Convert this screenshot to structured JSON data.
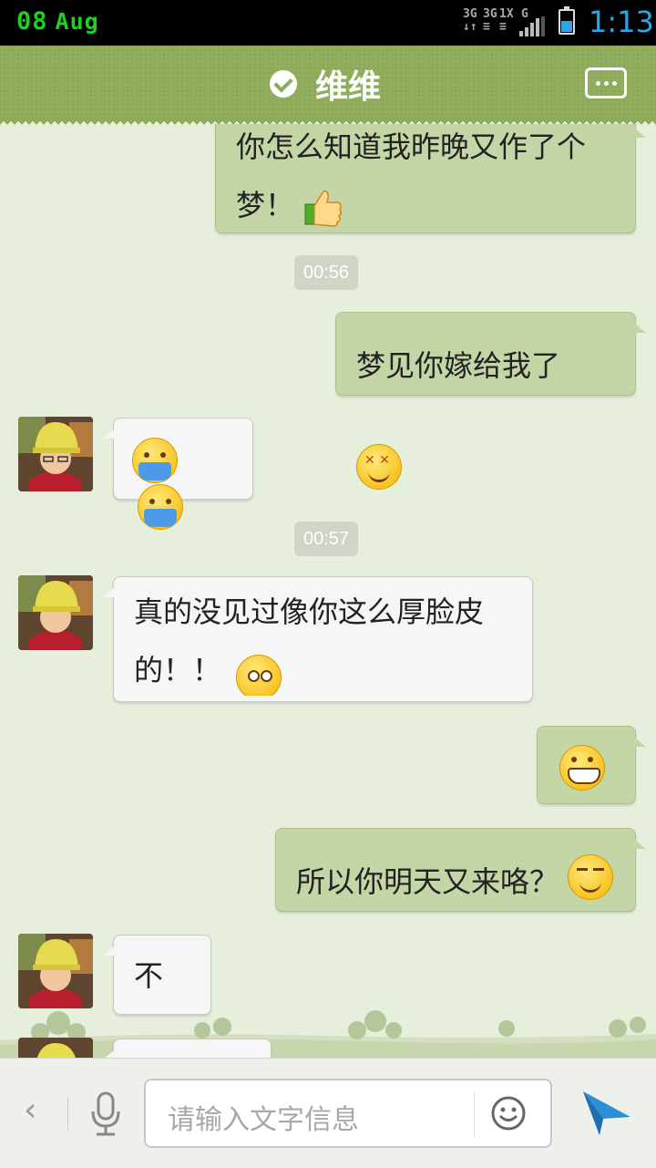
{
  "status_bar": {
    "date_day": "08",
    "date_month": "Aug",
    "time": "1:13",
    "net_labels": [
      "3G",
      "3G",
      "1X",
      "G"
    ],
    "battery_level": 0.55
  },
  "header": {
    "title": "维维"
  },
  "messages": [
    {
      "type": "mine",
      "text_line1": "你怎么知道我昨晚又作了个",
      "text_line2": "梦！",
      "emoji": "thumbs-up"
    },
    {
      "type": "time",
      "text": "00:56"
    },
    {
      "type": "mine",
      "text": "梦见你嫁给我了",
      "emoji": "dizzy-face"
    },
    {
      "type": "theirs",
      "emoji": "vomit-face"
    },
    {
      "type": "time",
      "text": "00:57"
    },
    {
      "type": "theirs",
      "text_line1": "真的没见过像你这么厚脸皮",
      "text_line2": "的！！",
      "emoji": "surprised-face"
    },
    {
      "type": "mine",
      "emoji": "grin-face"
    },
    {
      "type": "mine",
      "text": "所以你明天又来咯？",
      "emoji": "smirk-face"
    },
    {
      "type": "theirs",
      "text": "不要"
    }
  ],
  "input": {
    "placeholder": "请输入文字信息"
  },
  "colors": {
    "header": "#8eab5c",
    "mine_bubble": "#c4d6a6",
    "theirs_bubble": "#f6f6f6",
    "status_green": "#1ed11e",
    "time_blue": "#2aa7e6"
  }
}
